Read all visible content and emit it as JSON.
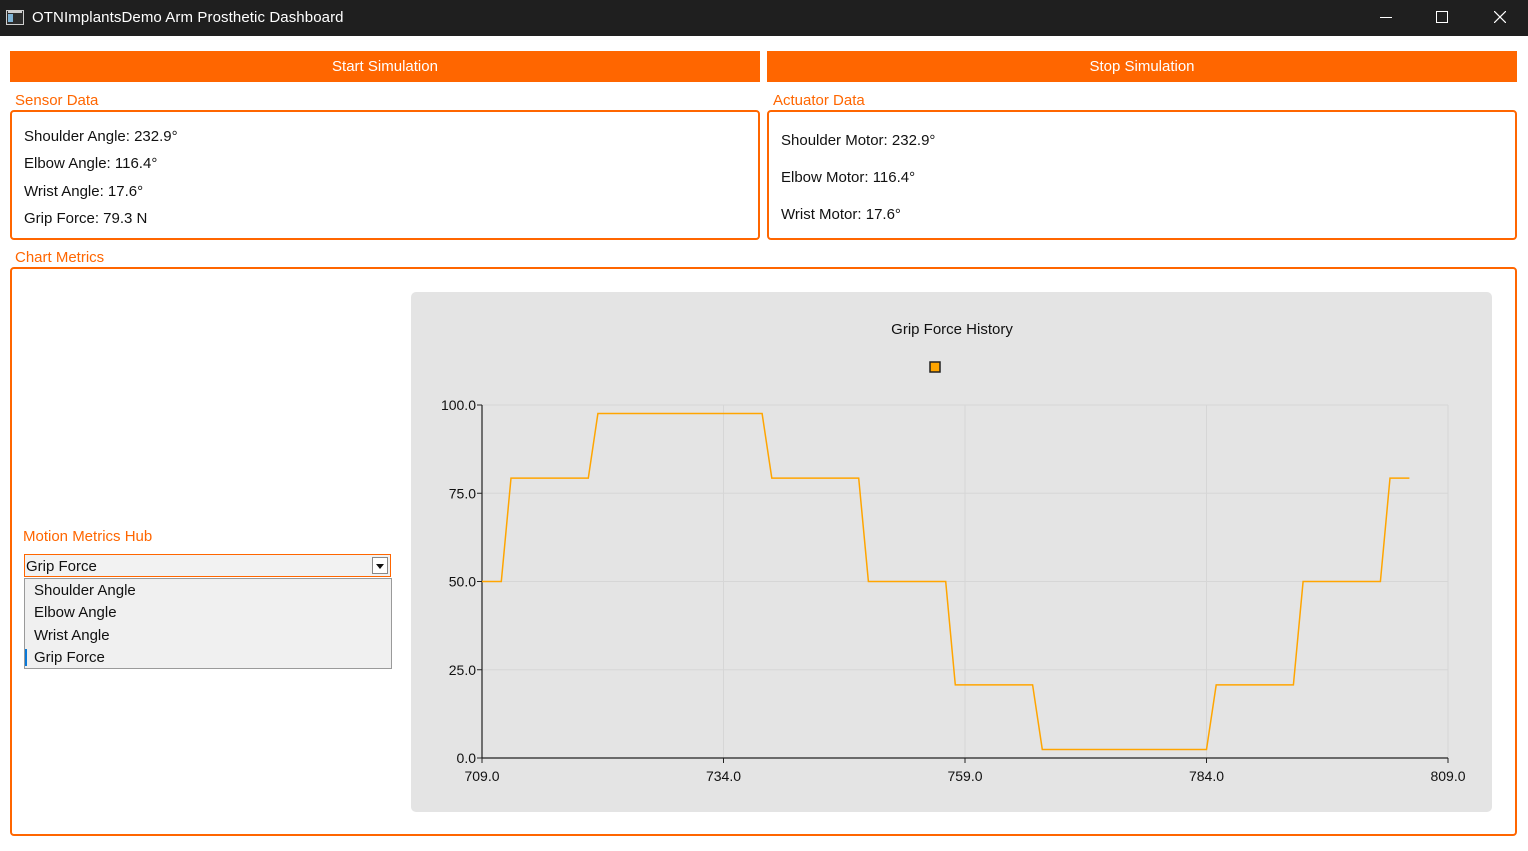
{
  "window": {
    "title": "OTNImplantsDemo Arm Prosthetic Dashboard"
  },
  "controls": {
    "start_label": "Start Simulation",
    "stop_label": "Stop Simulation"
  },
  "sensor": {
    "title": "Sensor Data",
    "lines": [
      "Shoulder Angle: 232.9°",
      "Elbow Angle: 116.4°",
      "Wrist Angle: 17.6°",
      "Grip Force: 79.3 N"
    ]
  },
  "actuator": {
    "title": "Actuator Data",
    "lines": [
      "Shoulder Motor: 232.9°",
      "Elbow Motor: 116.4°",
      "Wrist Motor: 17.6°"
    ]
  },
  "chart_metrics": {
    "title": "Chart Metrics",
    "hub_label": "Motion Metrics Hub",
    "selected": "Grip Force",
    "options": [
      "Shoulder Angle",
      "Elbow Angle",
      "Wrist Angle",
      "Grip Force"
    ]
  },
  "colors": {
    "accent": "#ff6600",
    "series": "#ffa500",
    "chart_bg": "#e4e4e4"
  },
  "chart_data": {
    "type": "line",
    "title": "Grip Force History",
    "xlabel": "",
    "ylabel": "",
    "xlim": [
      709,
      809
    ],
    "ylim": [
      0,
      100
    ],
    "xticks": [
      "709.0",
      "734.0",
      "759.0",
      "784.0",
      "809.0"
    ],
    "yticks": [
      "0.0",
      "25.0",
      "50.0",
      "75.0",
      "100.0"
    ],
    "grid": true,
    "legend": "top-center",
    "series": [
      {
        "color": "#ffa500",
        "x": [
          709,
          711,
          712,
          720,
          721,
          738,
          739,
          748,
          749,
          757,
          758,
          766,
          767,
          784,
          785,
          793,
          794,
          802,
          803,
          805
        ],
        "y": [
          50,
          50,
          79.3,
          79.3,
          97.6,
          97.6,
          79.3,
          79.3,
          50,
          50,
          20.7,
          20.7,
          2.4,
          2.4,
          20.7,
          20.7,
          50,
          50,
          79.3,
          79.3
        ]
      }
    ]
  }
}
